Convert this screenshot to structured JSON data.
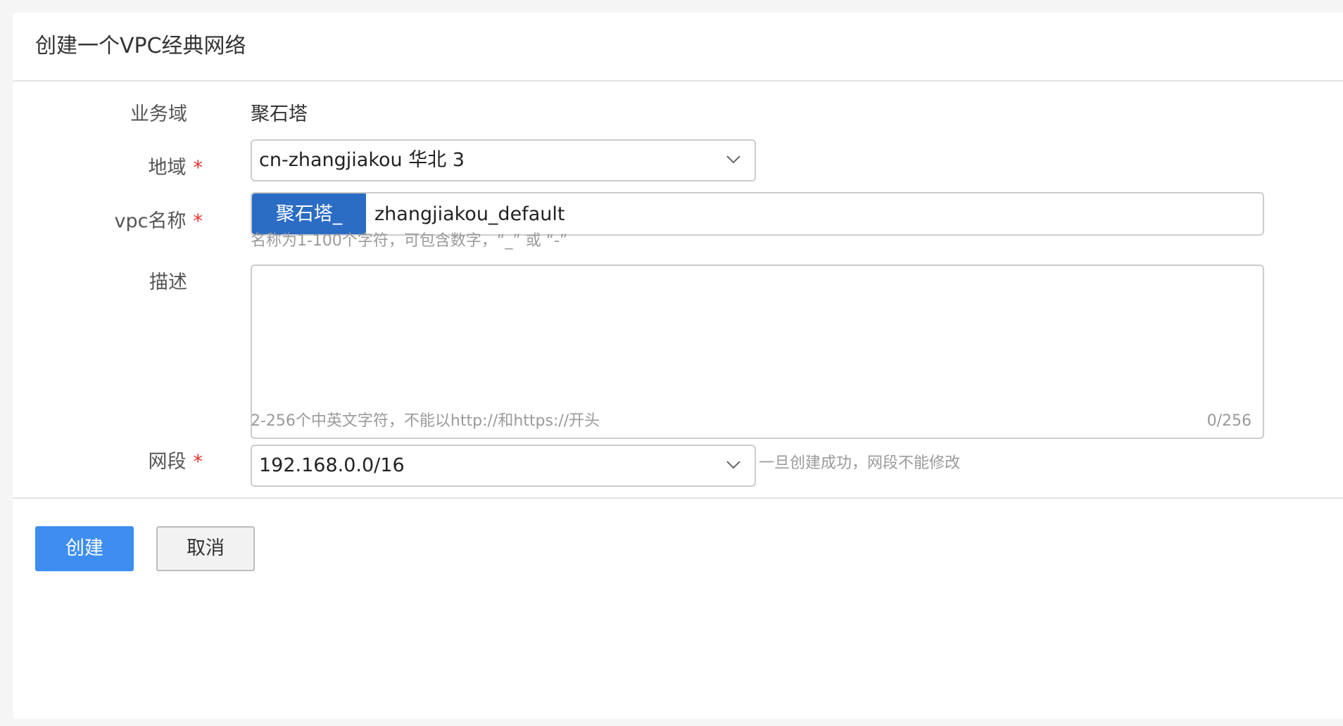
{
  "page": {
    "title": "创建一个VPC经典网络"
  },
  "form": {
    "business_domain": {
      "label": "业务域",
      "value": "聚石塔"
    },
    "region": {
      "label": "地域",
      "required_mark": "*",
      "selected": "cn-zhangjiakou 华北 3"
    },
    "vpc_name": {
      "label": "vpc名称",
      "required_mark": "*",
      "prefix": "聚石塔_",
      "value": "zhangjiakou_default",
      "hint": "名称为1-100个字符，可包含数字，“_” 或 “-”"
    },
    "description": {
      "label": "描述",
      "value": "",
      "char_count": "0/256",
      "hint": "2-256个中英文字符，不能以http://和https://开头"
    },
    "cidr": {
      "label": "网段",
      "required_mark": "*",
      "selected": "192.168.0.0/16",
      "side_hint": "一旦创建成功，网段不能修改"
    }
  },
  "footer": {
    "create_label": "创建",
    "cancel_label": "取消"
  },
  "colors": {
    "primary_button": "#3d8ef0",
    "prefix_background": "#2b6cc4",
    "required_mark": "#e5322e"
  },
  "icons": {
    "select_arrow": "chevron-down-icon"
  }
}
